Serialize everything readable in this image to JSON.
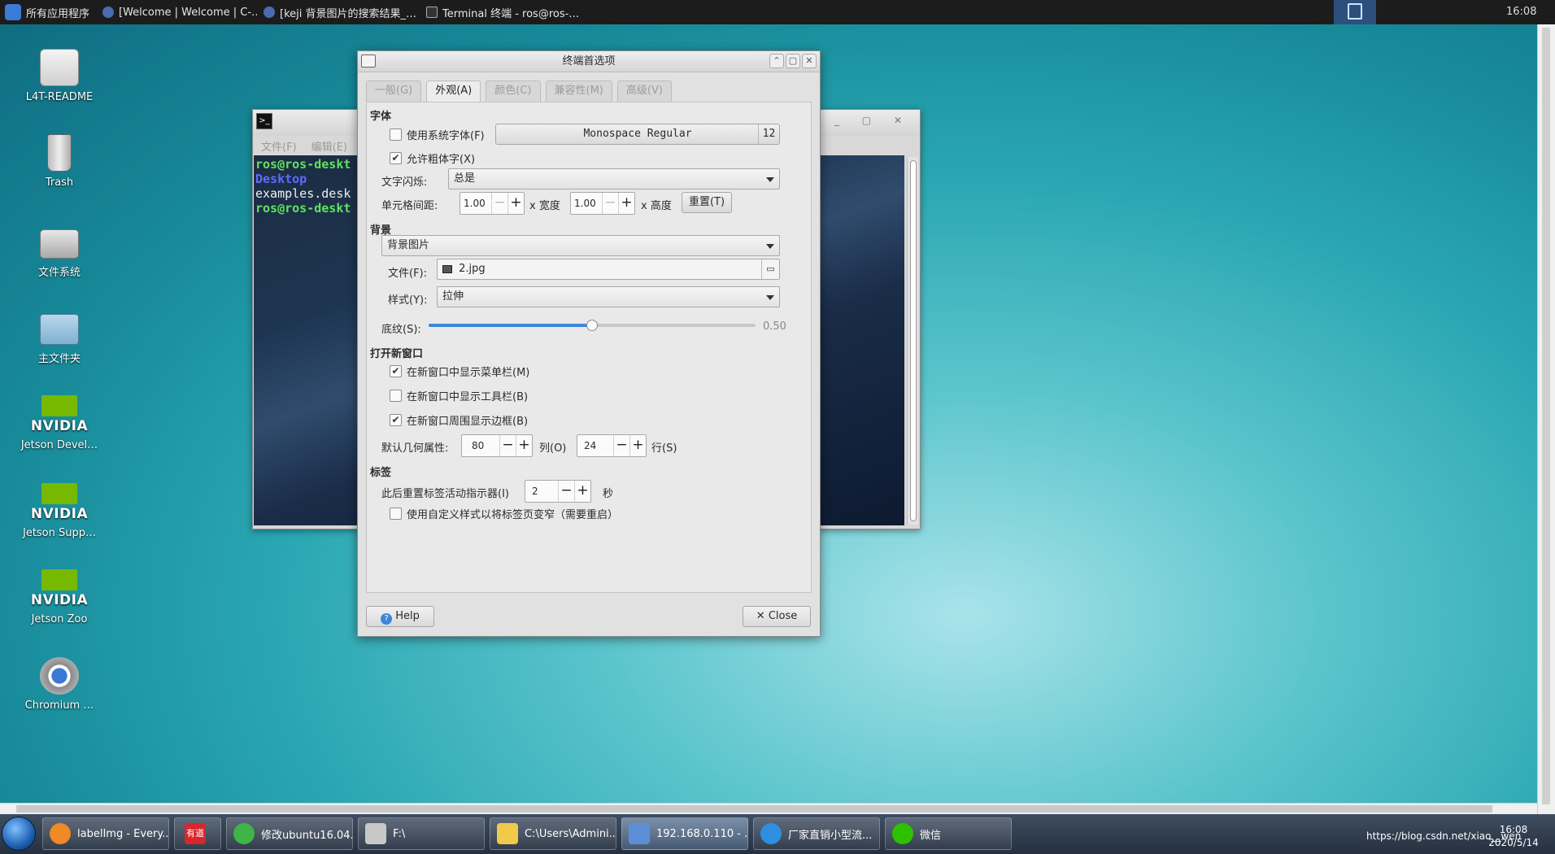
{
  "top_panel": {
    "apps_menu": "所有应用程序",
    "tasks": [
      "[Welcome | Welcome | C-…",
      "[keji 背景图片的搜索结果_…",
      "Terminal 终端 - ros@ros-…"
    ],
    "clock": "16:08"
  },
  "desktop_icons": [
    "L4T-README",
    "Trash",
    "文件系统",
    "主文件夹",
    "Jetson Devel…",
    "Jetson Supp…",
    "Jetson Zoo",
    "Chromium …"
  ],
  "nvidia_wordmark": "NVIDIA",
  "terminal": {
    "menu": [
      "文件(F)",
      "编辑(E)"
    ],
    "lines": [
      "ros@ros-deskt",
      "Desktop",
      "examples.desk",
      "ros@ros-deskt"
    ]
  },
  "dialog": {
    "title": "终端首选项",
    "tabs": [
      "一般(G)",
      "外观(A)",
      "颜色(C)",
      "兼容性(M)",
      "高级(V)"
    ],
    "font_section": "字体",
    "use_system_font": "使用系统字体(F)",
    "font_button": "Monospace Regular",
    "font_size": "12",
    "allow_bold": "允许粗体字(X)",
    "text_blink_label": "文字闪烁:",
    "text_blink_value": "总是",
    "cell_spacing_label": "单元格间距:",
    "cell_width": "1.00",
    "width_label": "x 宽度",
    "cell_height": "1.00",
    "height_label": "x 高度",
    "reset_button": "重置(T)",
    "bg_section": "背景",
    "bg_type": "背景图片",
    "file_label": "文件(F):",
    "file_value": "2.jpg",
    "style_label": "样式(Y):",
    "style_value": "拉伸",
    "shading_label": "底纹(S):",
    "shading_value": "0.50",
    "shading_fraction": 0.5,
    "new_window_section": "打开新窗口",
    "show_menubar": "在新窗口中显示菜单栏(M)",
    "show_toolbar": "在新窗口中显示工具栏(B)",
    "show_borders": "在新窗口周围显示边框(B)",
    "geometry_label": "默认几何属性:",
    "columns": "80",
    "columns_label": "列(O)",
    "rows": "24",
    "rows_label": "行(S)",
    "tabs_section": "标签",
    "reset_activity_label": "此后重置标签活动指示器(I)",
    "reset_activity_value": "2",
    "seconds_label": "秒",
    "narrow_tabs": "使用自定义样式以将标签页变窄（需要重启）",
    "help_button": "Help",
    "close_button": "Close"
  },
  "checkbox_states": {
    "use_system_font": false,
    "allow_bold": true,
    "show_menubar": true,
    "show_toolbar": false,
    "show_borders": true,
    "narrow_tabs": false
  },
  "taskbar": {
    "tasks": [
      "labelImg - Every...",
      "",
      "修改ubuntu16.04...",
      "F:\\",
      "C:\\Users\\Admini...",
      "192.168.0.110 - ...",
      "厂家直销小型流...",
      "微信"
    ],
    "youdao_label": "有道",
    "tray_url": "https://blog.csdn.net/xiao__wen",
    "clock_time": "16:08",
    "clock_date": "2020/5/14"
  },
  "colors": {
    "accent": "#3d86d8",
    "prompt_green": "#5fe35f",
    "dir_blue": "#5c6cff",
    "nvidia_green": "#76b900"
  }
}
